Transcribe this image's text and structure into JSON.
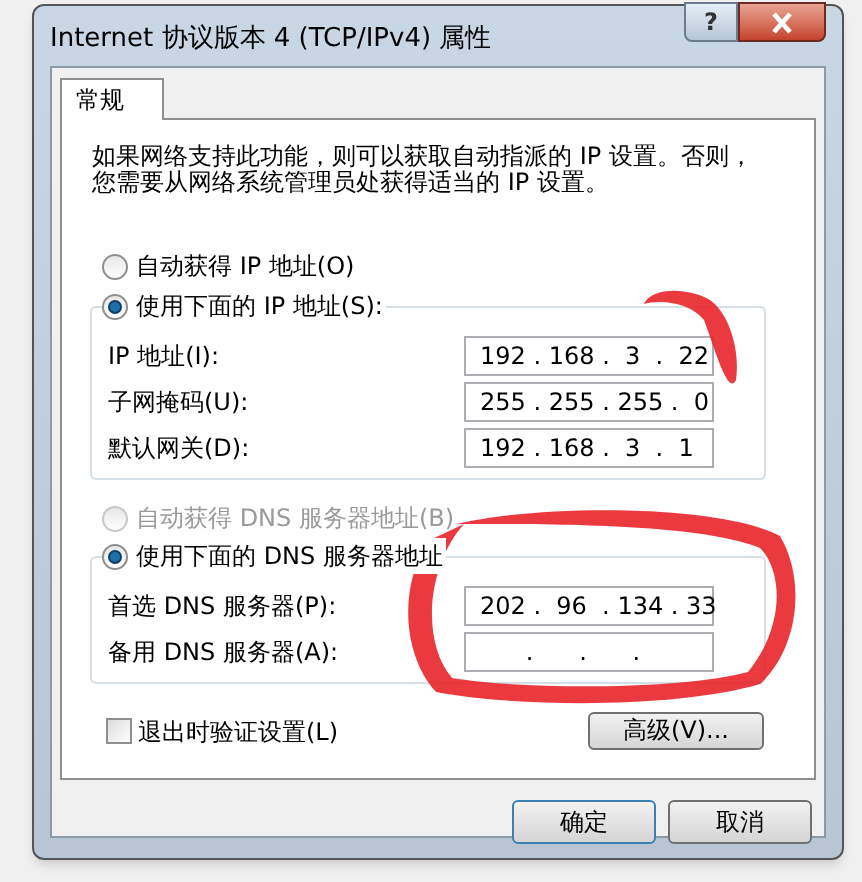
{
  "window": {
    "title": "Internet 协议版本 4 (TCP/IPv4) 属性",
    "help_label": "?"
  },
  "tabs": [
    {
      "label": "常规",
      "selected": true
    }
  ],
  "description": "如果网络支持此功能，则可以获取自动指派的 IP 设置。否则，您需要从网络系统管理员处获得适当的 IP 设置。",
  "ip_mode": [
    {
      "label": "自动获得 IP 地址(O)",
      "selected": false,
      "disabled": false
    },
    {
      "label": "使用下面的 IP 地址(S):",
      "selected": true,
      "disabled": false
    }
  ],
  "ip_fields": [
    {
      "label": "IP 地址(I):",
      "value": "192 . 168 .  3  .  22"
    },
    {
      "label": "子网掩码(U):",
      "value": "255 . 255 . 255 .  0"
    },
    {
      "label": "默认网关(D):",
      "value": "192 . 168 .  3  .  1"
    }
  ],
  "dns_mode": [
    {
      "label": "自动获得 DNS 服务器地址(B)",
      "selected": false,
      "disabled": true
    },
    {
      "label": "使用下面的 DNS 服务器地址",
      "selected": true,
      "disabled": false
    }
  ],
  "dns_fields": [
    {
      "label": "首选 DNS 服务器(P):",
      "value": "202 .  96  . 134 . 33"
    },
    {
      "label": "备用 DNS 服务器(A):",
      "value": "      .      .      ."
    }
  ],
  "validate": {
    "label": "退出时验证设置(L)",
    "checked": false
  },
  "advanced_button": "高级(V)...",
  "buttons": [
    "确定",
    "取消"
  ]
}
